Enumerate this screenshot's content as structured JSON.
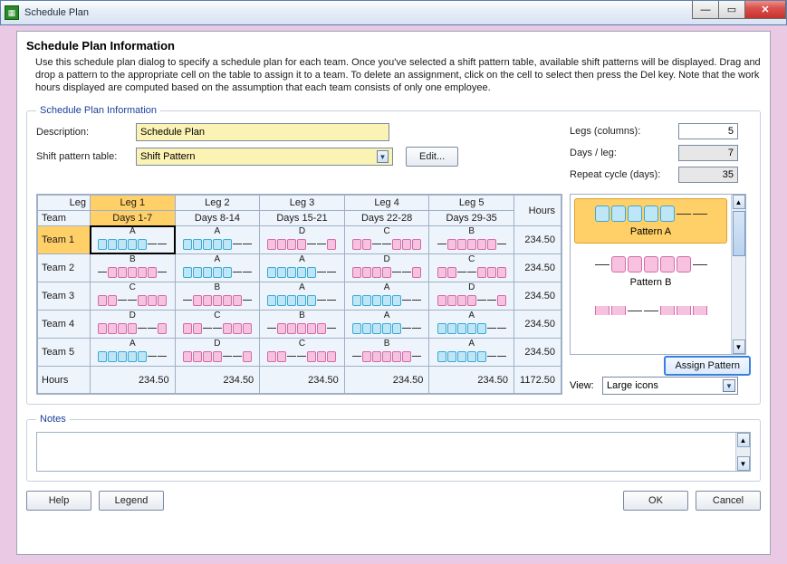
{
  "window": {
    "title": "Schedule Plan",
    "min": "—",
    "max": "▭",
    "close": "✕"
  },
  "header": {
    "title": "Schedule Plan Information",
    "intro": "Use this schedule plan dialog to specify a schedule plan for each team. Once you've selected a shift pattern table, available shift patterns will be displayed. Drag and drop a pattern to the appropriate cell on the table to assign it to a team. To delete an assignment, click on the cell to select then press the Del key. Note that the work hours displayed are computed based on the assumption that each team consists of only one employee."
  },
  "group_legend": "Schedule Plan Information",
  "labels": {
    "description": "Description:",
    "shift_table": "Shift pattern table:",
    "edit": "Edit...",
    "legs": "Legs (columns):",
    "days_per_leg": "Days / leg:",
    "repeat_cycle": "Repeat cycle (days):",
    "view": "View:",
    "assign": "Assign Pattern",
    "notes": "Notes",
    "help": "Help",
    "legend": "Legend",
    "ok": "OK",
    "cancel": "Cancel",
    "leg_header": "Leg",
    "team_header": "Team",
    "hours_header": "Hours"
  },
  "fields": {
    "description": "Schedule Plan",
    "shift_table": "Shift Pattern",
    "legs": "5",
    "days_per_leg": "7",
    "repeat_cycle": "35",
    "view": "Large icons"
  },
  "legs": [
    {
      "name": "Leg 1",
      "range": "Days 1-7"
    },
    {
      "name": "Leg 2",
      "range": "Days 8-14"
    },
    {
      "name": "Leg 3",
      "range": "Days 15-21"
    },
    {
      "name": "Leg 4",
      "range": "Days 22-28"
    },
    {
      "name": "Leg 5",
      "range": "Days 29-35"
    }
  ],
  "teams": [
    {
      "name": "Team 1",
      "cells": [
        "A",
        "A",
        "D",
        "C",
        "B"
      ],
      "hours": "234.50"
    },
    {
      "name": "Team 2",
      "cells": [
        "B",
        "A",
        "A",
        "D",
        "C"
      ],
      "hours": "234.50"
    },
    {
      "name": "Team 3",
      "cells": [
        "C",
        "B",
        "A",
        "A",
        "D"
      ],
      "hours": "234.50"
    },
    {
      "name": "Team 4",
      "cells": [
        "D",
        "C",
        "B",
        "A",
        "A"
      ],
      "hours": "234.50"
    },
    {
      "name": "Team 5",
      "cells": [
        "A",
        "D",
        "C",
        "B",
        "A"
      ],
      "hours": "234.50"
    }
  ],
  "col_hours": [
    "234.50",
    "234.50",
    "234.50",
    "234.50",
    "234.50"
  ],
  "total_hours": "1172.50",
  "hours_row_label": "Hours",
  "patternsA_name": "Pattern A",
  "patternsB_name": "Pattern B",
  "pattern_defs": {
    "A": [
      "blue",
      "blue",
      "blue",
      "blue",
      "blue",
      "dash",
      "dash"
    ],
    "B": [
      "dash",
      "pink",
      "pink",
      "pink",
      "pink",
      "pink",
      "dash"
    ],
    "C": [
      "pink",
      "pink",
      "dash",
      "dash",
      "pink",
      "pink",
      "pink"
    ],
    "D": [
      "pink",
      "pink",
      "pink",
      "pink",
      "dash",
      "dash",
      "pink"
    ]
  },
  "chart_data": {
    "type": "table",
    "columns": [
      "Leg 1",
      "Leg 2",
      "Leg 3",
      "Leg 4",
      "Leg 5",
      "Hours"
    ],
    "column_days": [
      "Days 1-7",
      "Days 8-14",
      "Days 15-21",
      "Days 22-28",
      "Days 29-35",
      ""
    ],
    "rows": [
      {
        "team": "Team 1",
        "patterns": [
          "A",
          "A",
          "D",
          "C",
          "B"
        ],
        "hours": 234.5
      },
      {
        "team": "Team 2",
        "patterns": [
          "B",
          "A",
          "A",
          "D",
          "C"
        ],
        "hours": 234.5
      },
      {
        "team": "Team 3",
        "patterns": [
          "C",
          "B",
          "A",
          "A",
          "D"
        ],
        "hours": 234.5
      },
      {
        "team": "Team 4",
        "patterns": [
          "D",
          "C",
          "B",
          "A",
          "A"
        ],
        "hours": 234.5
      },
      {
        "team": "Team 5",
        "patterns": [
          "A",
          "D",
          "C",
          "B",
          "A"
        ],
        "hours": 234.5
      }
    ],
    "column_hours": [
      234.5,
      234.5,
      234.5,
      234.5,
      234.5
    ],
    "total_hours": 1172.5
  }
}
